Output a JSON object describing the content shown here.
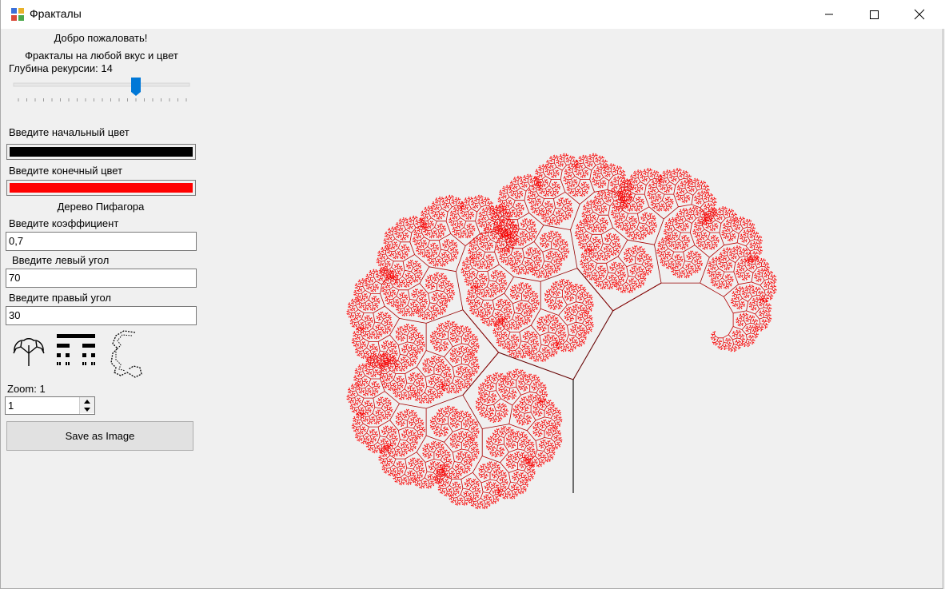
{
  "window": {
    "title": "Фракталы",
    "controls": [
      "minimize",
      "maximize",
      "close"
    ]
  },
  "panel": {
    "welcome": "Добро пожаловать!",
    "subtitle": "Фракталы на любой вкус и цвет",
    "depth_label": "Глубина рекурсии: 14",
    "depth_value": 14,
    "depth_max": 20,
    "start_color_label": "Введите начальный цвет",
    "start_color": "#000000",
    "end_color_label": "Введите конечный цвет",
    "end_color": "#ff0000",
    "fractal_name": "Дерево Пифагора",
    "coef_label": "Введите коэффициент",
    "coef_value": "0,7",
    "left_angle_label": "Введите левый угол",
    "left_angle_value": "70",
    "right_angle_label": "Введите правый угол",
    "right_angle_value": "30",
    "fractal_icons": [
      "tree-icon",
      "cantor-set-icon",
      "dragon-curve-icon"
    ],
    "zoom_label": "Zoom: 1",
    "zoom_value": "1",
    "save_button": "Save as Image"
  },
  "canvas": {
    "fractal": "pythagoras-tree",
    "depth": 14,
    "coefficient": 0.7,
    "left_angle": 70,
    "right_angle": 30
  }
}
